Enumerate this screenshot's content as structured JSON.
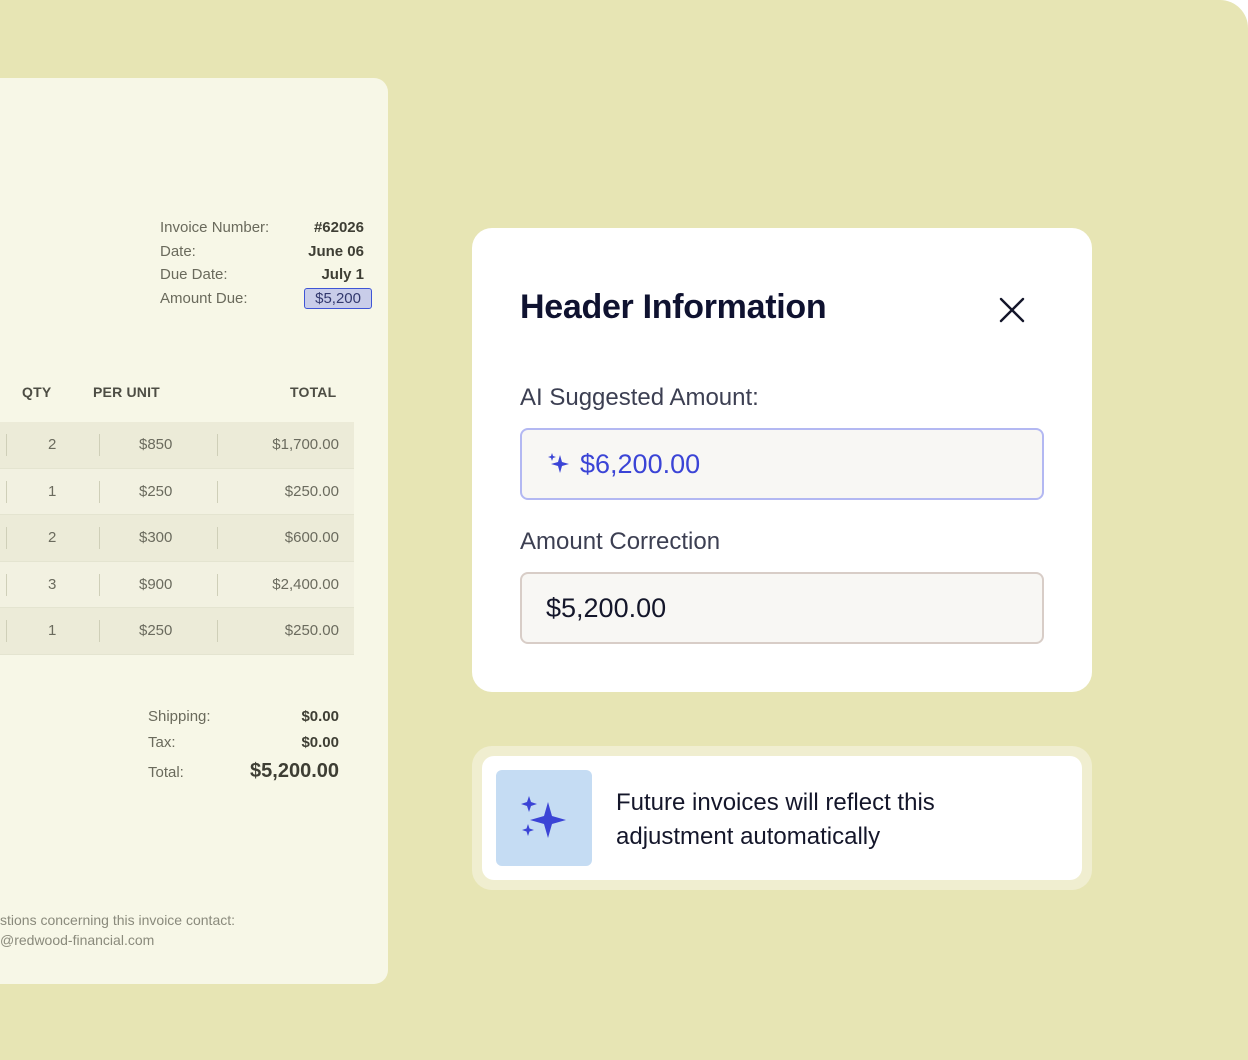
{
  "invoice": {
    "meta": [
      {
        "label": "Invoice Number:",
        "value": "#62026"
      },
      {
        "label": "Date:",
        "value": "June 06"
      },
      {
        "label": "Due Date:",
        "value": "July 1"
      },
      {
        "label": "Amount Due:",
        "value": "$5,200"
      }
    ],
    "columns": {
      "qty": "QTY",
      "per_unit": "PER UNIT",
      "total": "TOTAL"
    },
    "rows": [
      {
        "qty": "2",
        "per_unit": "$850",
        "total": "$1,700.00"
      },
      {
        "qty": "1",
        "per_unit": "$250",
        "total": "$250.00"
      },
      {
        "qty": "2",
        "per_unit": "$300",
        "total": "$600.00"
      },
      {
        "qty": "3",
        "per_unit": "$900",
        "total": "$2,400.00"
      },
      {
        "qty": "1",
        "per_unit": "$250",
        "total": "$250.00"
      }
    ],
    "totals": [
      {
        "label": "Shipping:",
        "value": "$0.00"
      },
      {
        "label": "Tax:",
        "value": "$0.00"
      },
      {
        "label": "Total:",
        "value": "$5,200.00"
      }
    ],
    "contact": {
      "line1": "stions concerning this invoice contact:",
      "line2": "@redwood-financial.com"
    }
  },
  "modal": {
    "title": "Header Information",
    "close_icon": "close-icon",
    "ai_label": "AI Suggested Amount:",
    "ai_value": "$6,200.00",
    "correction_label": "Amount Correction",
    "correction_value": "$5,200.00"
  },
  "notice": {
    "icon": "sparkles-icon",
    "text": "Future invoices will reflect this adjustment automatically"
  },
  "colors": {
    "background": "#e7e5b4",
    "accent": "#3b44d6",
    "notice_icon_bg": "#c5dcf3"
  }
}
